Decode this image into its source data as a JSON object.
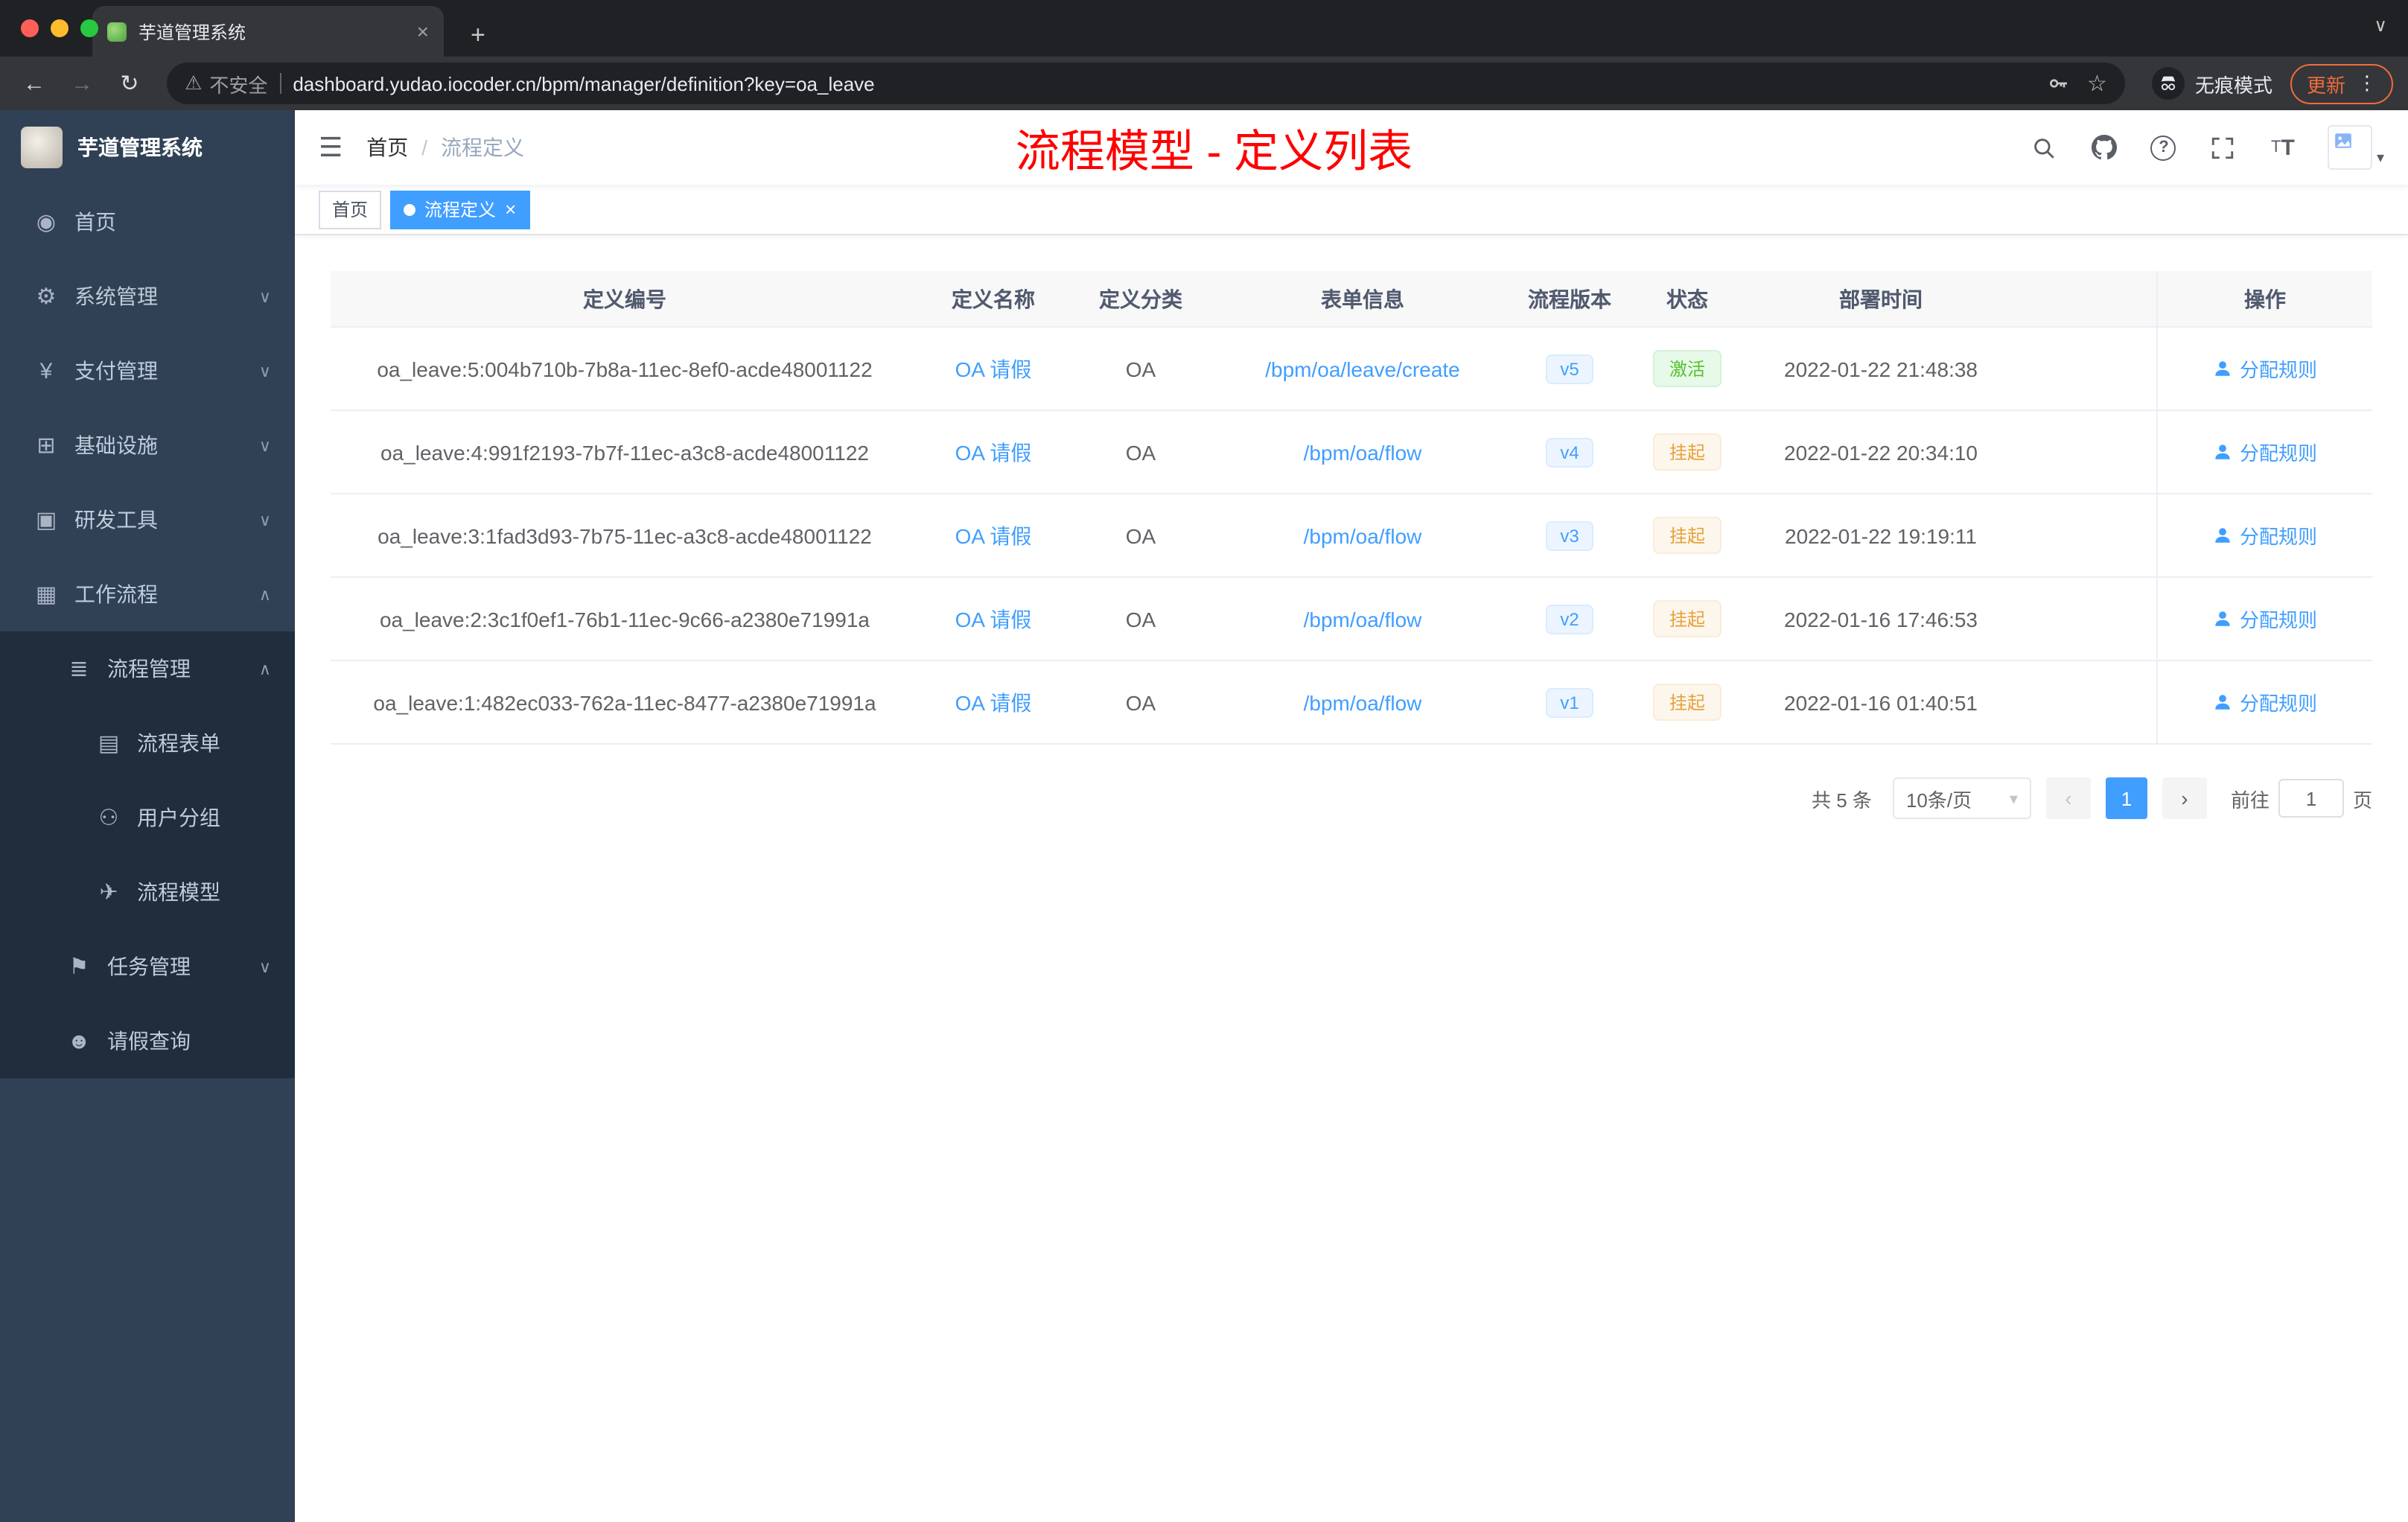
{
  "browser": {
    "tab": {
      "title": "芋道管理系统",
      "close": "×"
    },
    "new_tab": "+",
    "nav": {
      "back": "←",
      "forward": "→",
      "reload": "↻"
    },
    "security_label": "不安全",
    "warning_icon": "⚠",
    "url": "dashboard.yudao.iocoder.cn/bpm/manager/definition?key=oa_leave",
    "star_icon": "☆",
    "incognito_label": "无痕模式",
    "update_label": "更新",
    "kebab_icon": "⋮",
    "tabstrip_caret": "∨"
  },
  "sidebar": {
    "logo_title": "芋道管理系统",
    "items": [
      {
        "label": "首页",
        "icon": "◉"
      },
      {
        "label": "系统管理",
        "icon": "⚙",
        "chevron": "∨"
      },
      {
        "label": "支付管理",
        "icon": "¥",
        "chevron": "∨"
      },
      {
        "label": "基础设施",
        "icon": "⊞",
        "chevron": "∨"
      },
      {
        "label": "研发工具",
        "icon": "▣",
        "chevron": "∨"
      },
      {
        "label": "工作流程",
        "icon": "▦",
        "chevron": "∧"
      },
      {
        "label": "流程管理",
        "icon": "≣",
        "chevron": "∧"
      },
      {
        "label": "流程表单",
        "icon": "▤"
      },
      {
        "label": "用户分组",
        "icon": "⚇"
      },
      {
        "label": "流程模型",
        "icon": "✈"
      },
      {
        "label": "任务管理",
        "icon": "⚑",
        "chevron": "∨"
      },
      {
        "label": "请假查询",
        "icon": "☻"
      }
    ]
  },
  "header": {
    "hamburger_icon": "☰",
    "breadcrumb": {
      "home": "首页",
      "separator": "/",
      "current": "流程定义"
    },
    "overlay_title": "流程模型 - 定义列表",
    "font_icon_big": "T",
    "font_icon_small": "T",
    "question_mark": "?",
    "avatar_caret": "▾"
  },
  "tags": {
    "items": [
      {
        "label": "首页",
        "active": false
      },
      {
        "label": "流程定义",
        "active": true,
        "close": "×"
      }
    ]
  },
  "table": {
    "columns": [
      "定义编号",
      "定义名称",
      "定义分类",
      "表单信息",
      "流程版本",
      "状态",
      "部署时间",
      "操作"
    ],
    "rows": [
      {
        "id": "oa_leave:5:004b710b-7b8a-11ec-8ef0-acde48001122",
        "name": "OA 请假",
        "category": "OA",
        "form": "/bpm/oa/leave/create",
        "version": "v5",
        "status": "激活",
        "status_type": "success",
        "time": "2022-01-22 21:48:38",
        "action": "分配规则"
      },
      {
        "id": "oa_leave:4:991f2193-7b7f-11ec-a3c8-acde48001122",
        "name": "OA 请假",
        "category": "OA",
        "form": "/bpm/oa/flow",
        "version": "v4",
        "status": "挂起",
        "status_type": "warning",
        "time": "2022-01-22 20:34:10",
        "action": "分配规则"
      },
      {
        "id": "oa_leave:3:1fad3d93-7b75-11ec-a3c8-acde48001122",
        "name": "OA 请假",
        "category": "OA",
        "form": "/bpm/oa/flow",
        "version": "v3",
        "status": "挂起",
        "status_type": "warning",
        "time": "2022-01-22 19:19:11",
        "action": "分配规则"
      },
      {
        "id": "oa_leave:2:3c1f0ef1-76b1-11ec-9c66-a2380e71991a",
        "name": "OA 请假",
        "category": "OA",
        "form": "/bpm/oa/flow",
        "version": "v2",
        "status": "挂起",
        "status_type": "warning",
        "time": "2022-01-16 17:46:53",
        "action": "分配规则"
      },
      {
        "id": "oa_leave:1:482ec033-762a-11ec-8477-a2380e71991a",
        "name": "OA 请假",
        "category": "OA",
        "form": "/bpm/oa/flow",
        "version": "v1",
        "status": "挂起",
        "status_type": "warning",
        "time": "2022-01-16 01:40:51",
        "action": "分配规则"
      }
    ]
  },
  "pagination": {
    "total": "共 5 条",
    "page_size": "10条/页",
    "size_caret": "▾",
    "prev": "‹",
    "next": "›",
    "page": "1",
    "goto_label": "前往",
    "goto_value": "1",
    "goto_unit": "页"
  },
  "colors": {
    "primary": "#409eff",
    "success": "#67c23a",
    "warning": "#e6a23c",
    "annotation_red": "#ff0000",
    "sidebar_bg": "#304156",
    "submenu_bg": "#1f2d3d"
  }
}
